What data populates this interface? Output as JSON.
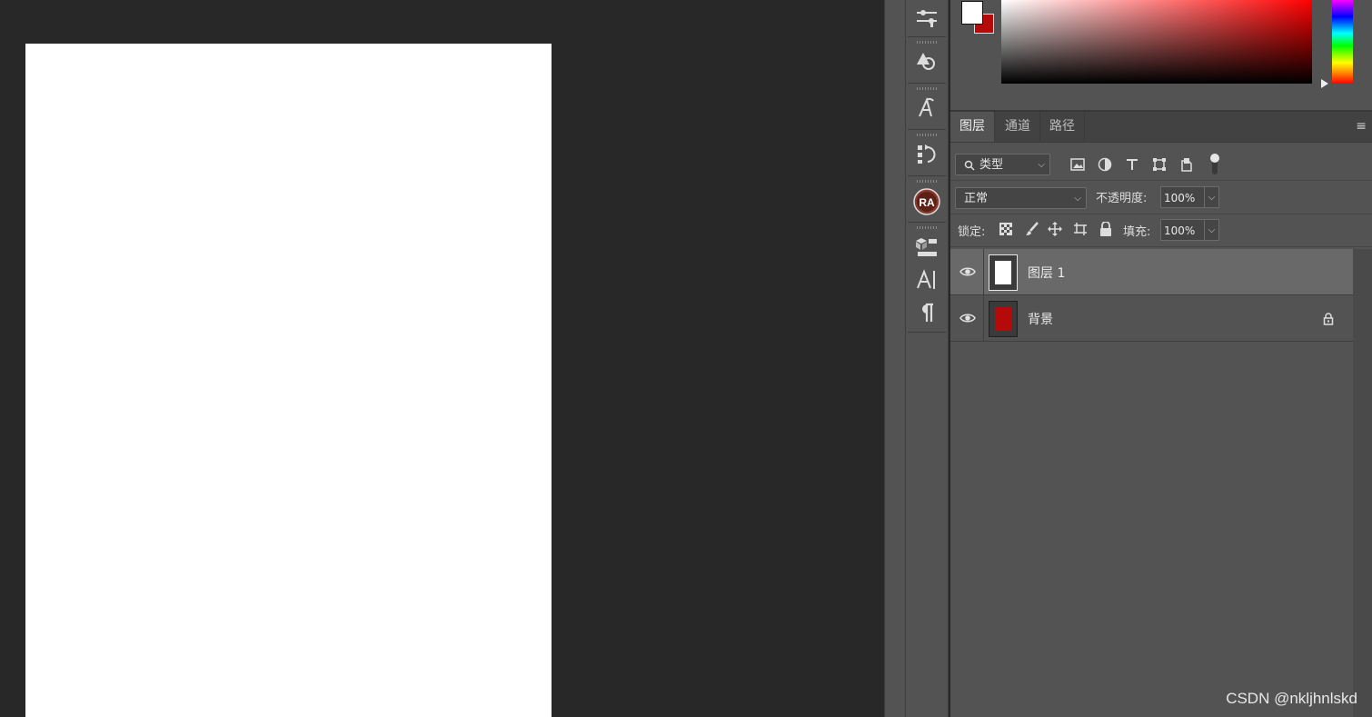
{
  "colors": {
    "foreground": "#ffffff",
    "background": "#b40a0a"
  },
  "dock": {
    "icons": [
      "adjustments-icon",
      "shapes-icon",
      "glyph-style-icon",
      "history-icon",
      "ra-plugin-icon",
      "3d-icon",
      "character-icon",
      "paragraph-icon"
    ],
    "ra_label": "RA"
  },
  "layers_panel": {
    "tabs": [
      {
        "label": "图层",
        "active": true
      },
      {
        "label": "通道",
        "active": false
      },
      {
        "label": "路径",
        "active": false
      }
    ],
    "filter": {
      "label": "类型"
    },
    "blend_mode": "正常",
    "opacity_label": "不透明度:",
    "opacity_value": "100%",
    "lock_label": "锁定:",
    "fill_label": "填充:",
    "fill_value": "100%",
    "layers": [
      {
        "name": "图层 1",
        "selected": true,
        "thumb_color": "#ffffff",
        "locked": false
      },
      {
        "name": "背景",
        "selected": false,
        "thumb_color": "#b40a0a",
        "locked": true
      }
    ]
  },
  "watermark": "CSDN @nkljhnlskd"
}
